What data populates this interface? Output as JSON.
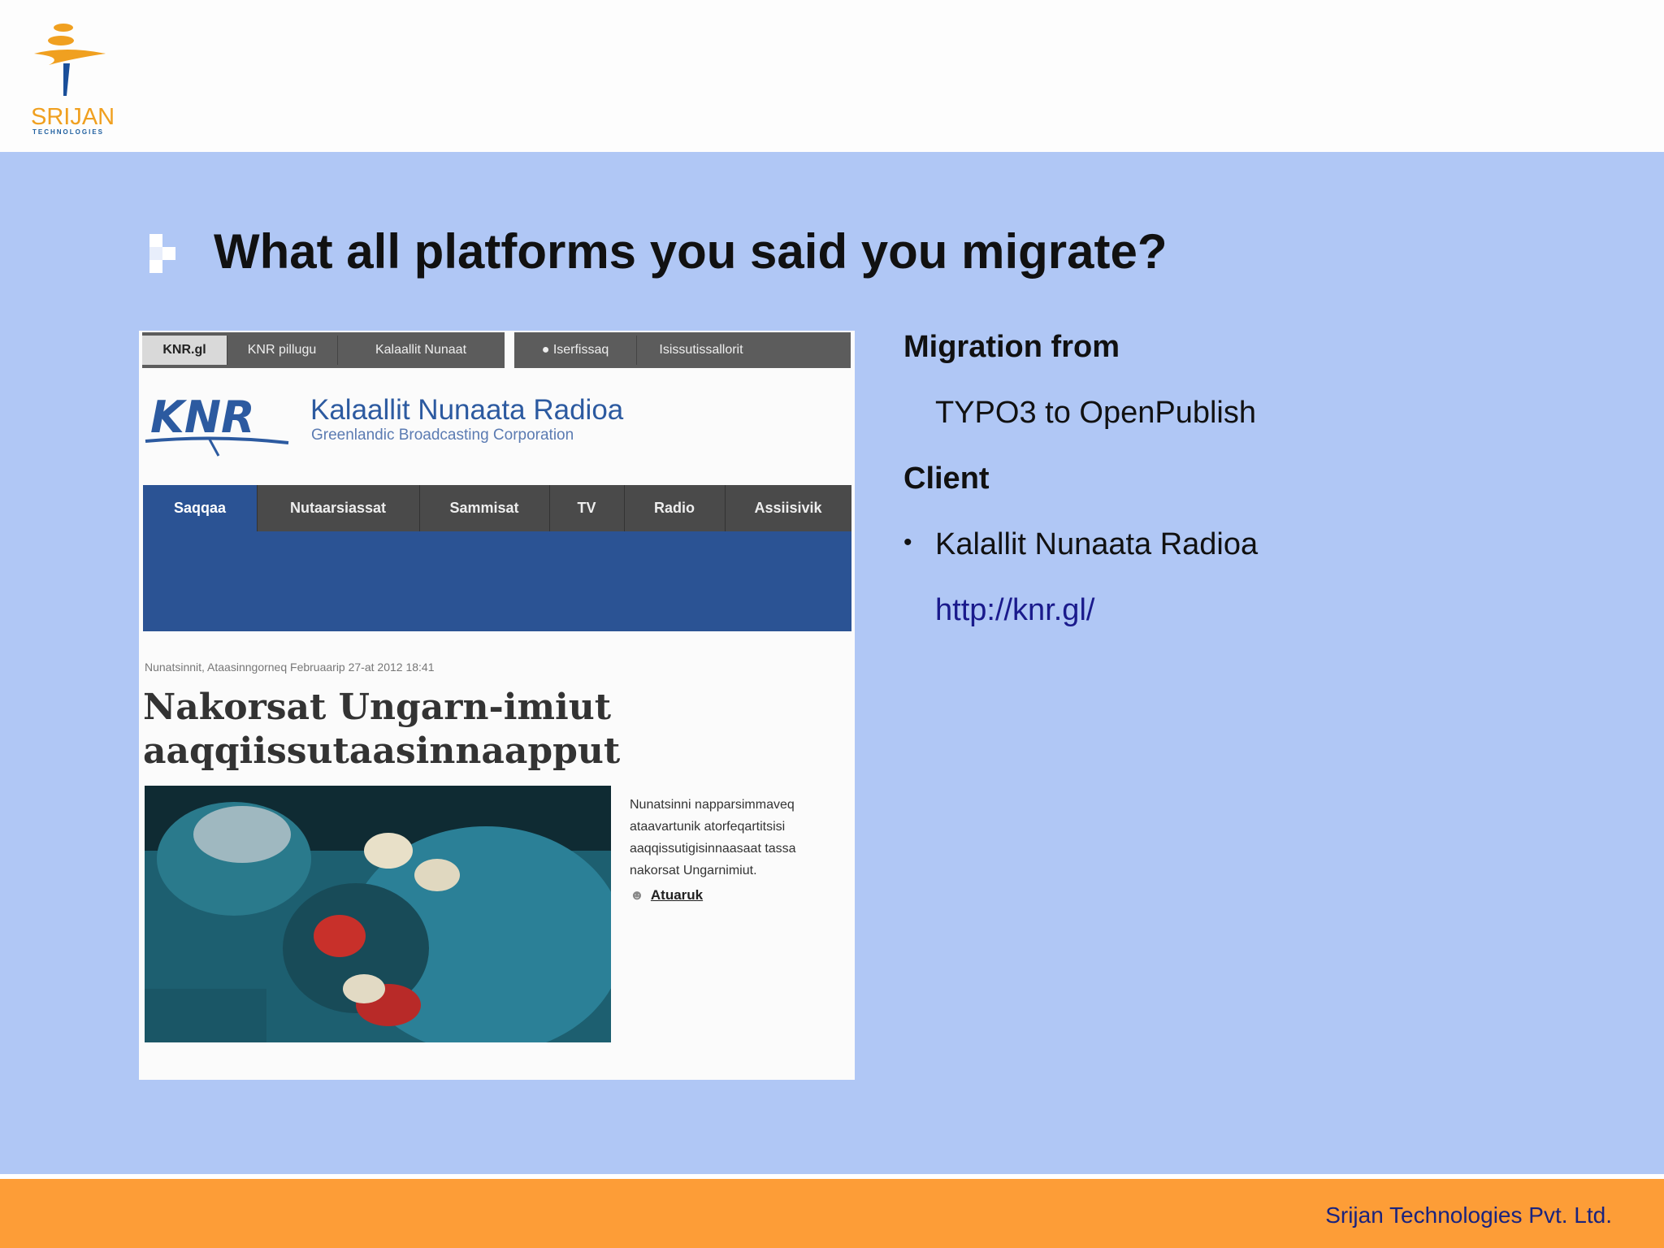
{
  "brand": {
    "logo_text": "SRIJAN",
    "logo_sub": "TECHNOLOGIES"
  },
  "slide": {
    "title": "What all platforms you said you migrate?",
    "migration_heading": "Migration from",
    "migration_text": "TYPO3 to OpenPublish",
    "client_heading": "Client",
    "client_name": "Kalallit Nunaata Radioa",
    "client_url": "http://knr.gl/"
  },
  "screenshot": {
    "top_tabs": [
      "KNR.gl",
      "KNR pillugu",
      "Kalaallit Nunaat",
      "Iserfissaq",
      "Isissutissallorit"
    ],
    "site_name": "Kalaallit Nunaata Radioa",
    "site_subtitle": "Greenlandic Broadcasting Corporation",
    "main_nav": [
      "Saqqaa",
      "Nutaarsiassat",
      "Sammisat",
      "TV",
      "Radio",
      "Assiisivik"
    ],
    "article_meta": "Nunatsinnit, Ataasinngorneq Februaarip 27-at 2012 18:41",
    "headline_line1": "Nakorsat Ungarn-imiut",
    "headline_line2": "aaqqiissutaasinnaapput",
    "teaser_lines": [
      "Nunatsinni napparsimmaveq",
      "ataavartunik atorfeqartitsisi",
      "aaqqissutigisinnaasaat tassa",
      "nakorsat Ungarnimiut."
    ],
    "more_link": "Atuaruk"
  },
  "footer": {
    "company": "Srijan Technologies Pvt. Ltd."
  },
  "colors": {
    "slide_bg": "#b0c7f5",
    "footer_bg": "#fd9d37",
    "link": "#1a1a8c",
    "knr_blue": "#2b5394"
  }
}
